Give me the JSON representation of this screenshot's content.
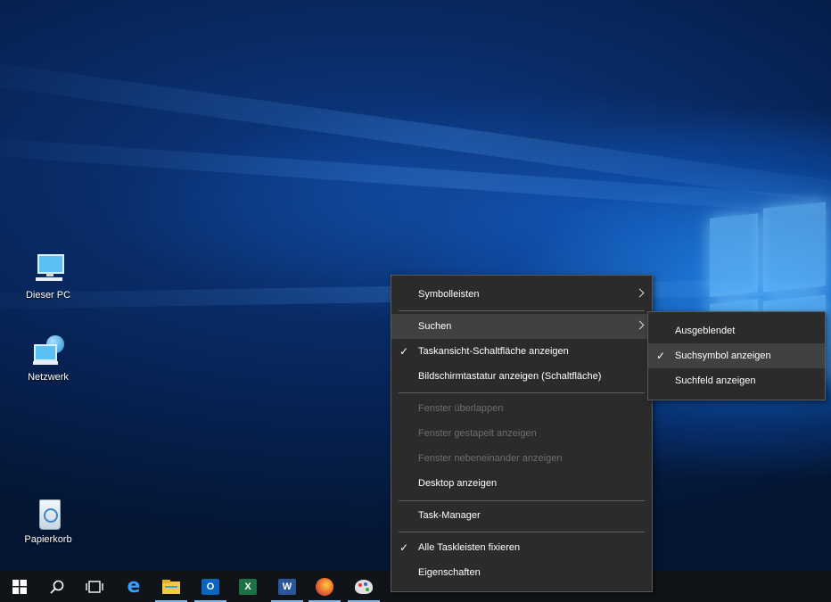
{
  "desktop": {
    "icons": [
      {
        "label": "Dieser PC",
        "icon": "computer-icon"
      },
      {
        "label": "Netzwerk",
        "icon": "network-icon"
      },
      {
        "label": "Papierkorb",
        "icon": "recycle-bin-icon"
      }
    ]
  },
  "taskbar": {
    "buttons": [
      {
        "icon": "start-icon"
      },
      {
        "icon": "search-icon"
      },
      {
        "icon": "task-view-icon"
      },
      {
        "icon": "edge-icon",
        "glyph": "e",
        "color": "#1f7bd6"
      },
      {
        "icon": "file-explorer-icon",
        "color": "#f2c94c"
      },
      {
        "icon": "outlook-icon",
        "glyph": "O",
        "color": "#0a64c2"
      },
      {
        "icon": "excel-icon",
        "glyph": "X",
        "color": "#1e7145"
      },
      {
        "icon": "word-icon",
        "glyph": "W",
        "color": "#2b579a"
      },
      {
        "icon": "firefox-icon",
        "color": "#e8652b"
      },
      {
        "icon": "paint-icon",
        "color": "#d8d8d8"
      }
    ]
  },
  "context_menu": {
    "items": [
      {
        "label": "Symbolleisten",
        "submenu": true
      },
      {
        "label": "Suchen",
        "submenu": true,
        "highlighted": true
      },
      {
        "label": "Taskansicht-Schaltfläche anzeigen",
        "checked": true
      },
      {
        "label": "Bildschirmtastatur anzeigen (Schaltfläche)"
      },
      {
        "label": "Fenster überlappen",
        "disabled": true
      },
      {
        "label": "Fenster gestapelt anzeigen",
        "disabled": true
      },
      {
        "label": "Fenster nebeneinander anzeigen",
        "disabled": true
      },
      {
        "label": "Desktop anzeigen"
      },
      {
        "label": "Task-Manager"
      },
      {
        "label": "Alle Taskleisten fixieren",
        "checked": true
      },
      {
        "label": "Eigenschaften"
      }
    ],
    "check_mark": "✓"
  },
  "search_submenu": {
    "items": [
      {
        "label": "Ausgeblendet"
      },
      {
        "label": "Suchsymbol anzeigen",
        "checked": true,
        "highlighted": true
      },
      {
        "label": "Suchfeld anzeigen"
      }
    ]
  }
}
